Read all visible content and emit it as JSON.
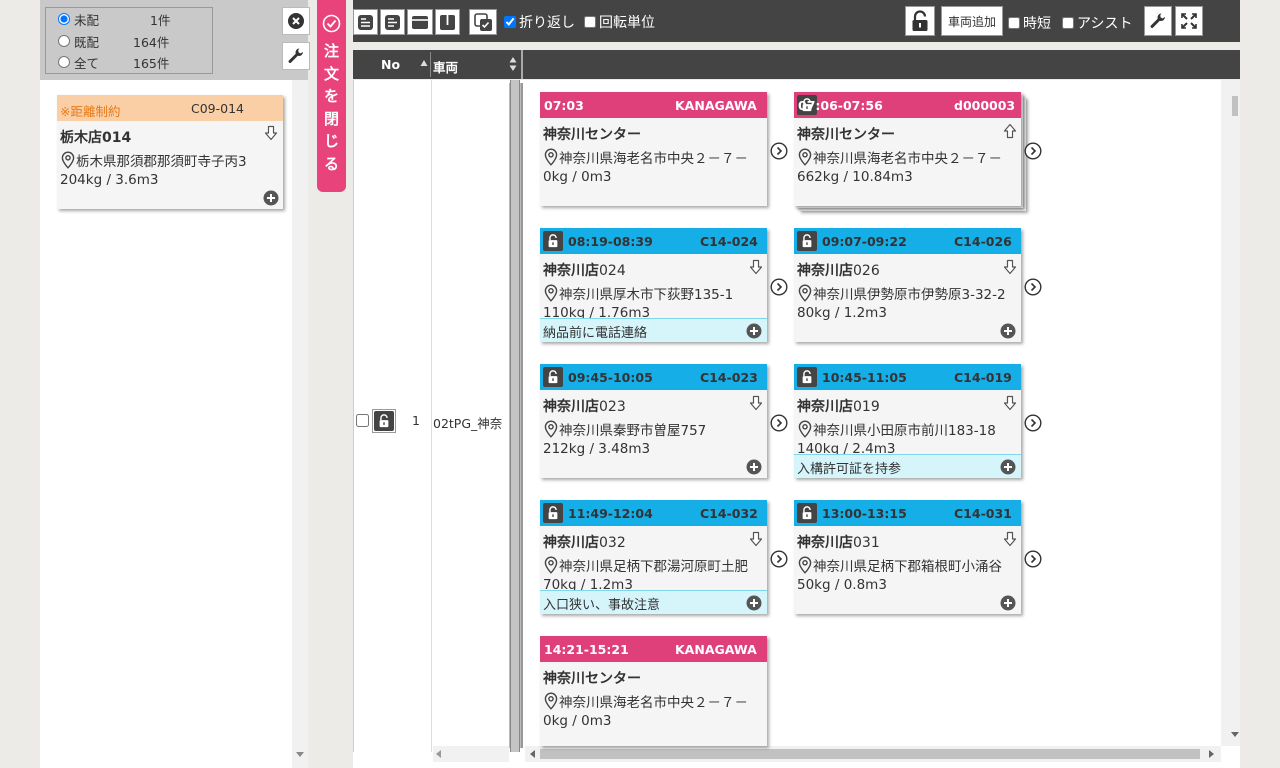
{
  "filters": [
    {
      "label": "未配",
      "count": "1件",
      "checked": true
    },
    {
      "label": "既配",
      "count": "164件",
      "checked": false
    },
    {
      "label": "全て",
      "count": "165件",
      "checked": false
    }
  ],
  "pending_card": {
    "warning": "※距離制約",
    "code": "C09-014",
    "store": "栃木店014",
    "address": "栃木県那須郡那須町寺子丙3",
    "weight": "204kg / 3.6m3"
  },
  "close_orders_label": "注\n文\nを\n閉\nじ\nる",
  "toolbar": {
    "wrap_label": "折り返し",
    "wrap_checked": true,
    "rotation_label": "回転単位",
    "rotation_checked": false,
    "add_vehicle_label": "車両追加",
    "shorten_label": "時短",
    "assist_label": "アシスト"
  },
  "grid_header": {
    "no": "No",
    "vehicle": "車両"
  },
  "row": {
    "no": "1",
    "vehicle": "02tPG_神奈"
  },
  "cards": {
    "c1": {
      "time": "07:03",
      "code": "KANAGAWA",
      "name": "神奈川センター",
      "address": "神奈川県海老名市中央２－７－",
      "weight": "0kg / 0m3"
    },
    "c2": {
      "time": "07:06-07:56",
      "code": "d000003",
      "name": "神奈川センター",
      "address": "神奈川県海老名市中央２－７－",
      "weight": "662kg / 10.84m3"
    },
    "c3": {
      "time": "08:19-08:39",
      "code": "C14-024",
      "name_bold": "神奈川店",
      "name_num": "024",
      "address": "神奈川県厚木市下荻野135-1",
      "weight": "110kg / 1.76m3",
      "note": "納品前に電話連絡"
    },
    "c4": {
      "time": "09:07-09:22",
      "code": "C14-026",
      "name_bold": "神奈川店",
      "name_num": "026",
      "address": "神奈川県伊勢原市伊勢原3-32-2",
      "weight": "80kg / 1.2m3"
    },
    "c5": {
      "time": "09:45-10:05",
      "code": "C14-023",
      "name_bold": "神奈川店",
      "name_num": "023",
      "address": "神奈川県秦野市曽屋757",
      "weight": "212kg / 3.48m3"
    },
    "c6": {
      "time": "10:45-11:05",
      "code": "C14-019",
      "name_bold": "神奈川店",
      "name_num": "019",
      "address": "神奈川県小田原市前川183-18",
      "weight": "140kg / 2.4m3",
      "note": "入構許可証を持参"
    },
    "c7": {
      "time": "11:49-12:04",
      "code": "C14-032",
      "name_bold": "神奈川店",
      "name_num": "032",
      "address": "神奈川県足柄下郡湯河原町土肥",
      "weight": "70kg / 1.2m3",
      "note": "入口狭い、事故注意"
    },
    "c8": {
      "time": "13:00-13:15",
      "code": "C14-031",
      "name_bold": "神奈川店",
      "name_num": "031",
      "address": "神奈川県足柄下郡箱根町小涌谷",
      "weight": "50kg / 0.8m3"
    },
    "c9": {
      "time": "14:21-15:21",
      "code": "KANAGAWA",
      "name": "神奈川センター",
      "address": "神奈川県海老名市中央２－７－",
      "weight": "0kg / 0m3"
    }
  },
  "colors": {
    "center_header": "#e0407a",
    "store_header": "#15aee6",
    "warning_header": "#fbcfa5",
    "note_bg": "#d5f5fb",
    "toolbar": "#444444"
  }
}
